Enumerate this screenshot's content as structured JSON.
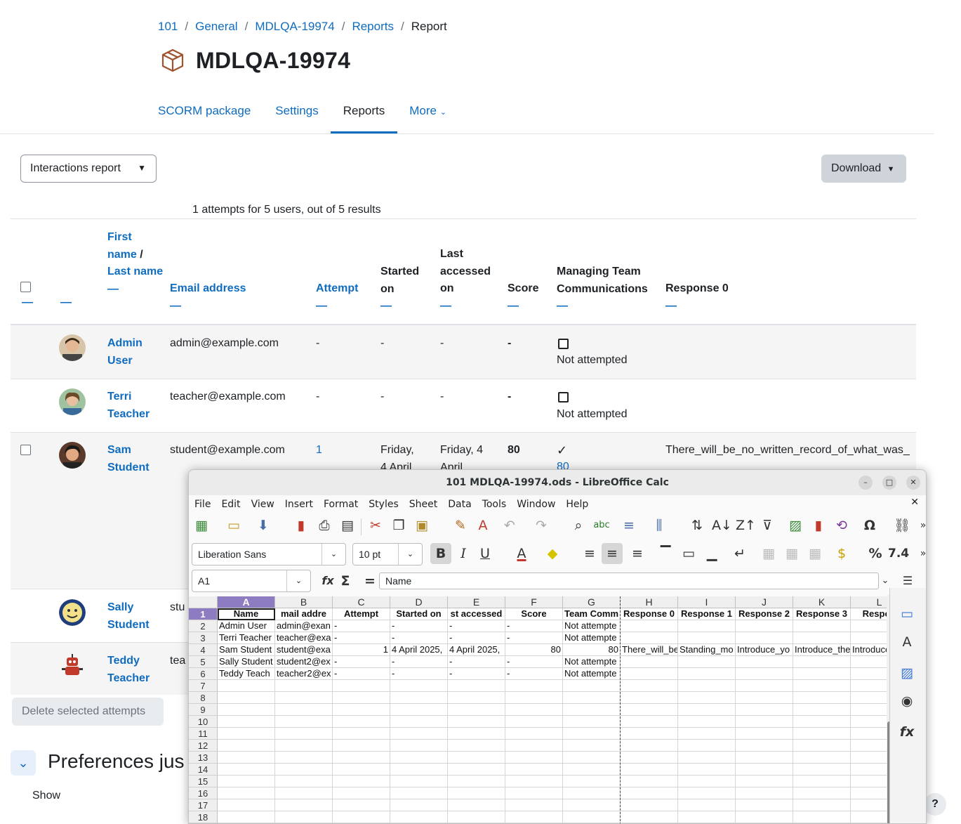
{
  "breadcrumb": [
    "101",
    "General",
    "MDLQA-19974",
    "Reports",
    "Report"
  ],
  "page_title": "MDLQA-19974",
  "tabs": [
    {
      "label": "SCORM package"
    },
    {
      "label": "Settings"
    },
    {
      "label": "Reports"
    },
    {
      "label": "More"
    }
  ],
  "report_select": "Interactions report",
  "download_label": "Download",
  "summary": "1 attempts for 5 users, out of 5 results",
  "table": {
    "headers": {
      "name_first": "First name",
      "name_sep": " / ",
      "name_last": "Last name",
      "email": "Email address",
      "attempt": "Attempt",
      "started": "Started on",
      "last_accessed": "Last accessed on",
      "score": "Score",
      "question": "Managing Team Communications",
      "response0": "Response 0"
    },
    "rows": [
      {
        "first": "Admin",
        "last": "User",
        "email": "admin@example.com",
        "attempt": "-",
        "started": "-",
        "accessed": "-",
        "score": "-",
        "status_icon": "checkbox-empty-icon",
        "status": "Not attempted",
        "response": ""
      },
      {
        "first": "Terri",
        "last": "Teacher",
        "email": "teacher@example.com",
        "attempt": "-",
        "started": "-",
        "accessed": "-",
        "score": "-",
        "status_icon": "checkbox-empty-icon",
        "status": "Not attempted",
        "response": ""
      },
      {
        "first": "Sam",
        "last": "Student",
        "email": "student@example.com",
        "attempt": "1",
        "started": "Friday,\n4 April",
        "accessed": "Friday, 4\nApril",
        "score": "80",
        "status_icon": "checkmark-icon",
        "status": "80",
        "response": "There_will_be_no_written_record_of_what_was_"
      },
      {
        "first": "Sally",
        "last": "Student",
        "email": "stu",
        "attempt": "",
        "started": "",
        "accessed": "",
        "score": "",
        "status_icon": "",
        "status": "",
        "response": ""
      },
      {
        "first": "Teddy",
        "last": "Teacher",
        "email": "tea",
        "attempt": "",
        "started": "",
        "accessed": "",
        "score": "",
        "status_icon": "",
        "status": "",
        "response": ""
      }
    ]
  },
  "delete_button": "Delete selected attempts",
  "preferences_title": "Preferences jus",
  "show_label": "Show",
  "help_label": "?",
  "calc": {
    "window_title": "101 MDLQA-19974.ods - LibreOffice Calc",
    "menu": [
      "File",
      "Edit",
      "View",
      "Insert",
      "Format",
      "Styles",
      "Sheet",
      "Data",
      "Tools",
      "Window",
      "Help"
    ],
    "font_name": "Liberation Sans",
    "font_size": "10 pt",
    "cell_ref": "A1",
    "formula": "Name",
    "number_format_label": "7.4",
    "percent_label": "%",
    "columns": [
      "A",
      "B",
      "C",
      "D",
      "E",
      "F",
      "G",
      "H",
      "I",
      "J",
      "K",
      "L"
    ],
    "row_numbers": [
      "1",
      "2",
      "3",
      "4",
      "5",
      "6",
      "7",
      "8",
      "9",
      "10",
      "11",
      "12",
      "13",
      "14",
      "15",
      "16",
      "17",
      "18"
    ],
    "grid": [
      [
        "Name",
        "mail addre",
        "Attempt",
        "Started on",
        "st accessed",
        "Score",
        "Team Comm",
        "Response 0",
        "Response 1",
        "Response 2",
        "Response 3",
        "Respon"
      ],
      [
        "Admin User",
        "admin@exan",
        "-",
        "-",
        "-",
        "-",
        "Not attempte",
        "",
        "",
        "",
        "",
        ""
      ],
      [
        "Terri Teacher",
        "teacher@exa",
        "-",
        "-",
        "-",
        "-",
        "Not attempte",
        "",
        "",
        "",
        "",
        ""
      ],
      [
        "Sam Student",
        "student@exa",
        "1",
        "4 April 2025,",
        "4 April 2025,",
        "80",
        "80",
        "There_will_be",
        "Standing_mo",
        "Introduce_yo",
        "Introduce_the",
        "Introduce"
      ],
      [
        "Sally Student",
        "student2@ex",
        "-",
        "-",
        "-",
        "-",
        "Not attempte",
        "",
        "",
        "",
        "",
        ""
      ],
      [
        "Teddy Teach",
        "teacher2@ex",
        "-",
        "-",
        "-",
        "-",
        "Not attempte",
        "",
        "",
        "",
        "",
        ""
      ]
    ]
  }
}
